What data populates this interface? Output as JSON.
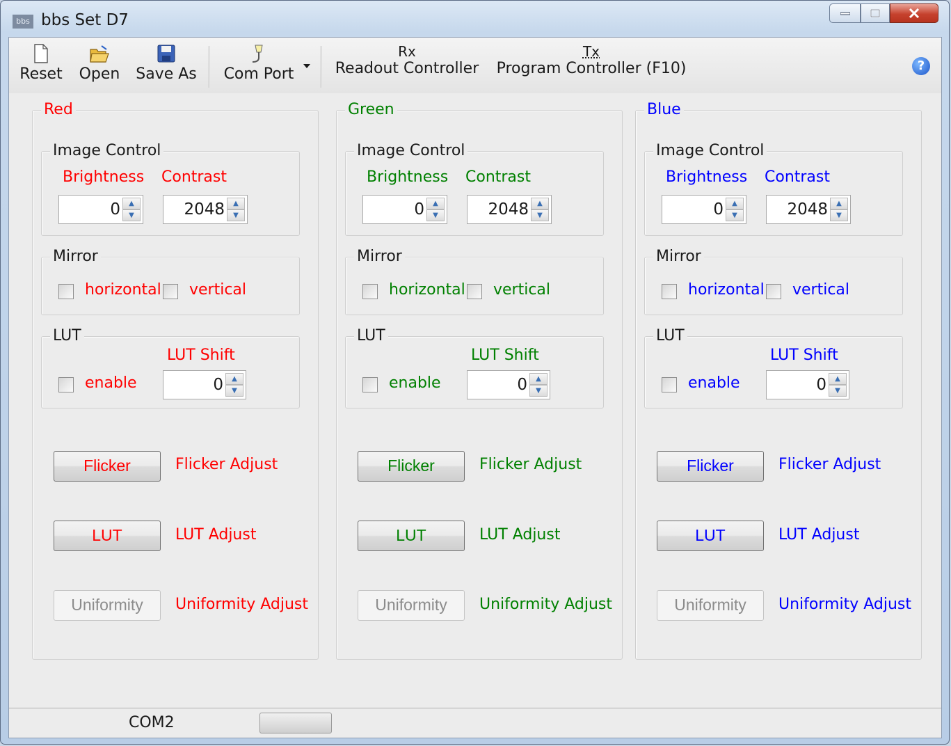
{
  "window": {
    "title": "bbs Set D7",
    "icon_text": "bbs"
  },
  "toolbar": {
    "reset_label": "Reset",
    "open_label": "Open",
    "save_as_label": "Save As",
    "com_port_label": "Com Port",
    "readout_glyph": "Rx",
    "readout_label": "Readout Controller",
    "program_glyph": "Tx",
    "program_label": "Program Controller (F10)",
    "help_glyph": "?"
  },
  "channels": [
    {
      "name": "Red",
      "color": "#ff0000",
      "image_control": "Image Control",
      "brightness_label": "Brightness",
      "brightness_value": "0",
      "contrast_label": "Contrast",
      "contrast_value": "2048",
      "mirror": "Mirror",
      "horizontal_label": "horizontal",
      "vertical_label": "vertical",
      "lut_group": "LUT",
      "enable_label": "enable",
      "lut_shift_label": "LUT Shift",
      "lut_shift_value": "0",
      "flicker_button": "Flicker",
      "flicker_adjust": "Flicker Adjust",
      "lut_button": "LUT",
      "lut_adjust": "LUT Adjust",
      "uniformity_button": "Uniformity",
      "uniformity_adjust": "Uniformity Adjust"
    },
    {
      "name": "Green",
      "color": "#008000",
      "image_control": "Image Control",
      "brightness_label": "Brightness",
      "brightness_value": "0",
      "contrast_label": "Contrast",
      "contrast_value": "2048",
      "mirror": "Mirror",
      "horizontal_label": "horizontal",
      "vertical_label": "vertical",
      "lut_group": "LUT",
      "enable_label": "enable",
      "lut_shift_label": "LUT Shift",
      "lut_shift_value": "0",
      "flicker_button": "Flicker",
      "flicker_adjust": "Flicker Adjust",
      "lut_button": "LUT",
      "lut_adjust": "LUT Adjust",
      "uniformity_button": "Uniformity",
      "uniformity_adjust": "Uniformity Adjust"
    },
    {
      "name": "Blue",
      "color": "#0000ff",
      "image_control": "Image Control",
      "brightness_label": "Brightness",
      "brightness_value": "0",
      "contrast_label": "Contrast",
      "contrast_value": "2048",
      "mirror": "Mirror",
      "horizontal_label": "horizontal",
      "vertical_label": "vertical",
      "lut_group": "LUT",
      "enable_label": "enable",
      "lut_shift_label": "LUT Shift",
      "lut_shift_value": "0",
      "flicker_button": "Flicker",
      "flicker_adjust": "Flicker Adjust",
      "lut_button": "LUT",
      "lut_adjust": "LUT Adjust",
      "uniformity_button": "Uniformity",
      "uniformity_adjust": "Uniformity Adjust"
    }
  ],
  "status": {
    "com_port": "COM2"
  }
}
